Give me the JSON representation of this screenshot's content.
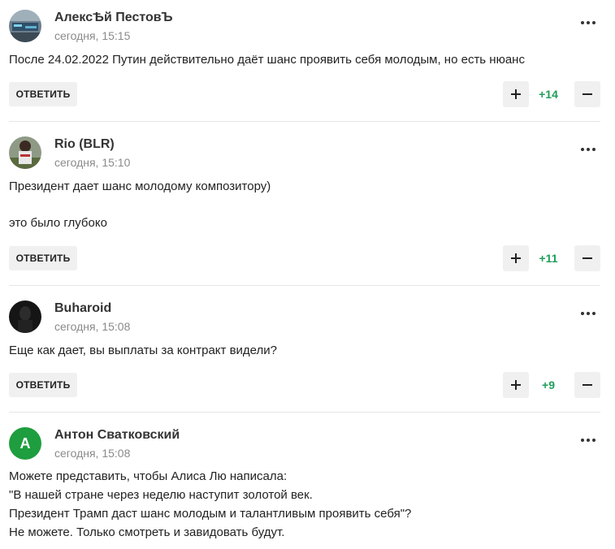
{
  "ui": {
    "reply_label": "ОТВЕТИТЬ",
    "more_icon": "more-dots-icon",
    "plus_icon": "plus-icon",
    "minus_icon": "minus-icon"
  },
  "colors": {
    "score": "#1e9e5a",
    "button_bg": "#f0f0f0",
    "avatar_green": "#1e9e3e"
  },
  "comments": [
    {
      "author": "АлексѢй ПестовЪ",
      "time": "сегодня, 15:15",
      "text": [
        "После 24.02.2022 Путин действительно даёт шанс проявить себя молодым, но есть нюанс"
      ],
      "score": "+14"
    },
    {
      "author": "Rio (BLR)",
      "time": "сегодня, 15:10",
      "text": [
        "Президент дает шанс молодому композитору)",
        "это было глубоко"
      ],
      "score": "+11"
    },
    {
      "author": "Buharoid",
      "time": "сегодня, 15:08",
      "text": [
        "Еще как дает, вы выплаты за контракт видели?"
      ],
      "score": "+9"
    },
    {
      "author": "Антон Сватковский",
      "avatar_letter": "А",
      "time": "сегодня, 15:08",
      "text": [
        "Можете представить, чтобы Алиса Лю написала:",
        "\"В нашей стране через неделю наступит золотой век.",
        "Президент Трамп даст шанс молодым и талантливым проявить себя\"?",
        "Не можете. Только смотреть и завидовать будут."
      ]
    }
  ]
}
